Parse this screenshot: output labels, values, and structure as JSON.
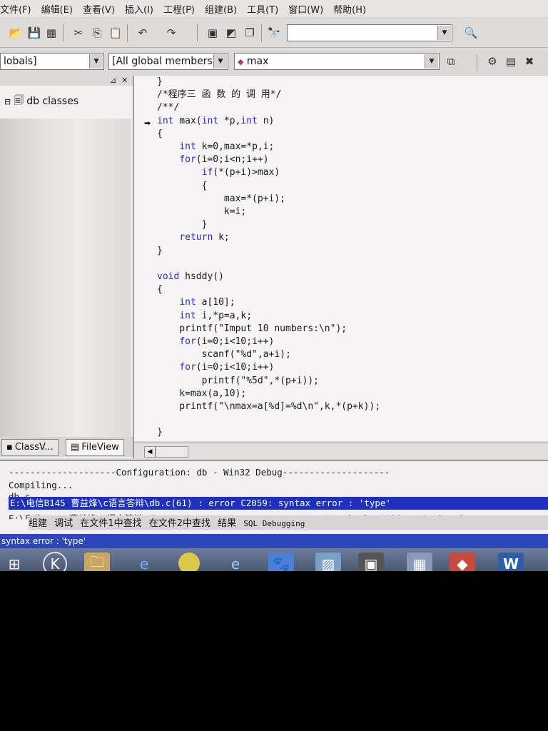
{
  "menu": [
    "文件(F)",
    "编辑(E)",
    "查看(V)",
    "插入(I)",
    "工程(P)",
    "组建(B)",
    "工具(T)",
    "窗口(W)",
    "帮助(H)"
  ],
  "toolbar2": {
    "scope_combo": "lobals]",
    "members_combo": "[All global members",
    "function_combo": "max"
  },
  "leftpane": {
    "tree_root": "db classes",
    "tab_classview": "ClassV...",
    "tab_fileview": "FileView"
  },
  "editor": {
    "lines": [
      "}",
      "/*程序三 函 数 的 调 用*/",
      "/**/",
      "int max(int *p,int n)",
      "{",
      "    int k=0,max=*p,i;",
      "    for(i=0;i<n;i++)",
      "        if(*(p+i)>max)",
      "        {",
      "            max=*(p+i);",
      "            k=i;",
      "        }",
      "    return k;",
      "}",
      "",
      "void hsddy()",
      "{",
      "    int a[10];",
      "    int i,*p=a,k;",
      "    printf(\"Imput 10 numbers:\\n\");",
      "    for(i=0;i<10;i++)",
      "        scanf(\"%d\",a+i);",
      "    for(i=0;i<10;i++)",
      "        printf(\"%5d\",*(p+i));",
      "    k=max(a,10);",
      "    printf(\"\\nmax=a[%d]=%d\\n\",k,*(p+k));",
      "",
      "}"
    ]
  },
  "output": {
    "config_line": "--------------------Configuration: db - Win32 Debug--------------------",
    "compiling": "Compiling...",
    "file": "db.c",
    "error_line": "E:\\电信B145 曹益烽\\c语言答辩\\db.c(61) : error C2059: syntax error : 'type'",
    "warning_line": "E:\\电信B145 曹益烽\\c语言答辩\\db.c(82) : warning C4047: '=' : 'int [10]' differs in levels",
    "tabs": [
      "组建",
      "调试",
      "在文件1中查找",
      "在文件2中查找",
      "结果",
      "SQL Debugging"
    ]
  },
  "status": "syntax error : 'type'",
  "colors": {
    "keyword": "#2a2ad0",
    "selection": "#1f2fbf",
    "statusbar": "#2d46b8"
  }
}
